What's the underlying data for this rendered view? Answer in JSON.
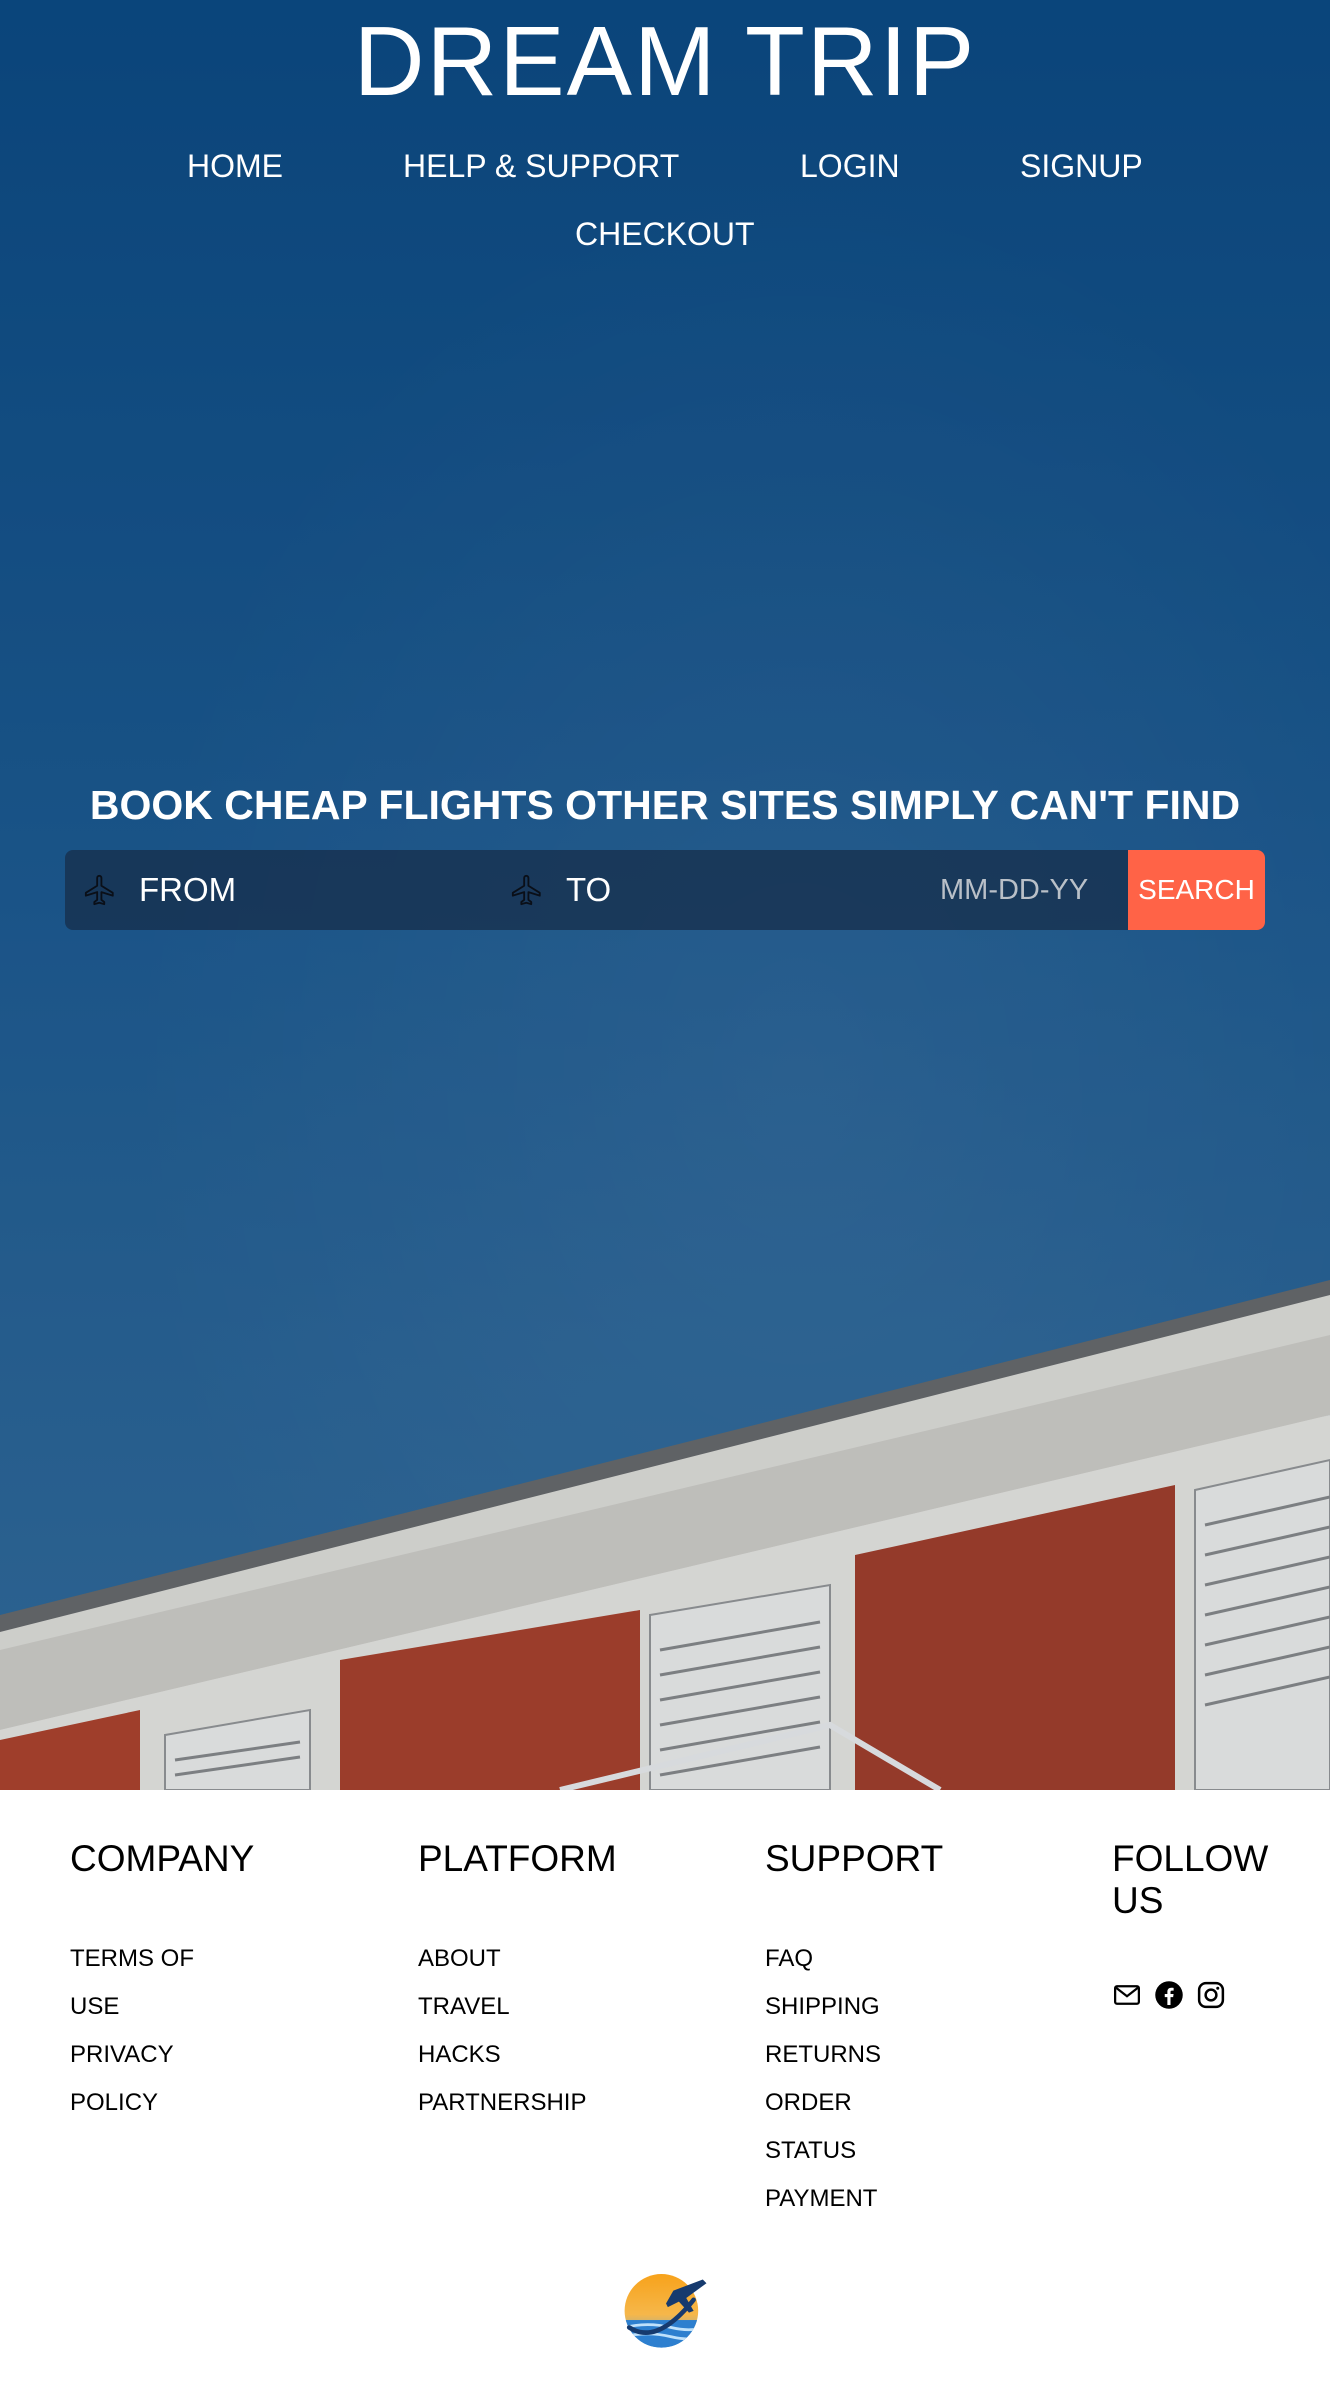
{
  "site": {
    "title": "DREAM TRIP"
  },
  "nav": {
    "items": [
      {
        "label": "HOME"
      },
      {
        "label": "HELP & SUPPORT"
      },
      {
        "label": "LOGIN"
      },
      {
        "label": "SIGNUP"
      },
      {
        "label": "CHECKOUT"
      }
    ]
  },
  "hero": {
    "tagline": "BOOK CHEAP FLIGHTS OTHER SITES SIMPLY CAN'T FIND"
  },
  "search": {
    "from_label": "FROM",
    "to_label": "TO",
    "date_placeholder": "MM-DD-YY",
    "button_label": "SEARCH",
    "button_color": "#ff6347"
  },
  "footer": {
    "columns": [
      {
        "heading": "COMPANY",
        "links": [
          "TERMS OF",
          "USE",
          "PRIVACY",
          "POLICY"
        ]
      },
      {
        "heading": "PLATFORM",
        "links": [
          "ABOUT",
          "TRAVEL",
          "HACKS",
          "PARTNERSHIP"
        ]
      },
      {
        "heading": "SUPPORT",
        "links": [
          "FAQ",
          "SHIPPING",
          "RETURNS",
          "ORDER",
          "STATUS",
          "PAYMENT"
        ]
      },
      {
        "heading_line1": "FOLLOW",
        "heading_line2": "US",
        "icons": [
          "mail-icon",
          "facebook-icon",
          "instagram-icon"
        ]
      }
    ]
  },
  "colors": {
    "sky_top": "#0b4a84",
    "sky_bottom": "#336d9d",
    "accent": "#ff6347",
    "building_red": "#b4432a"
  }
}
